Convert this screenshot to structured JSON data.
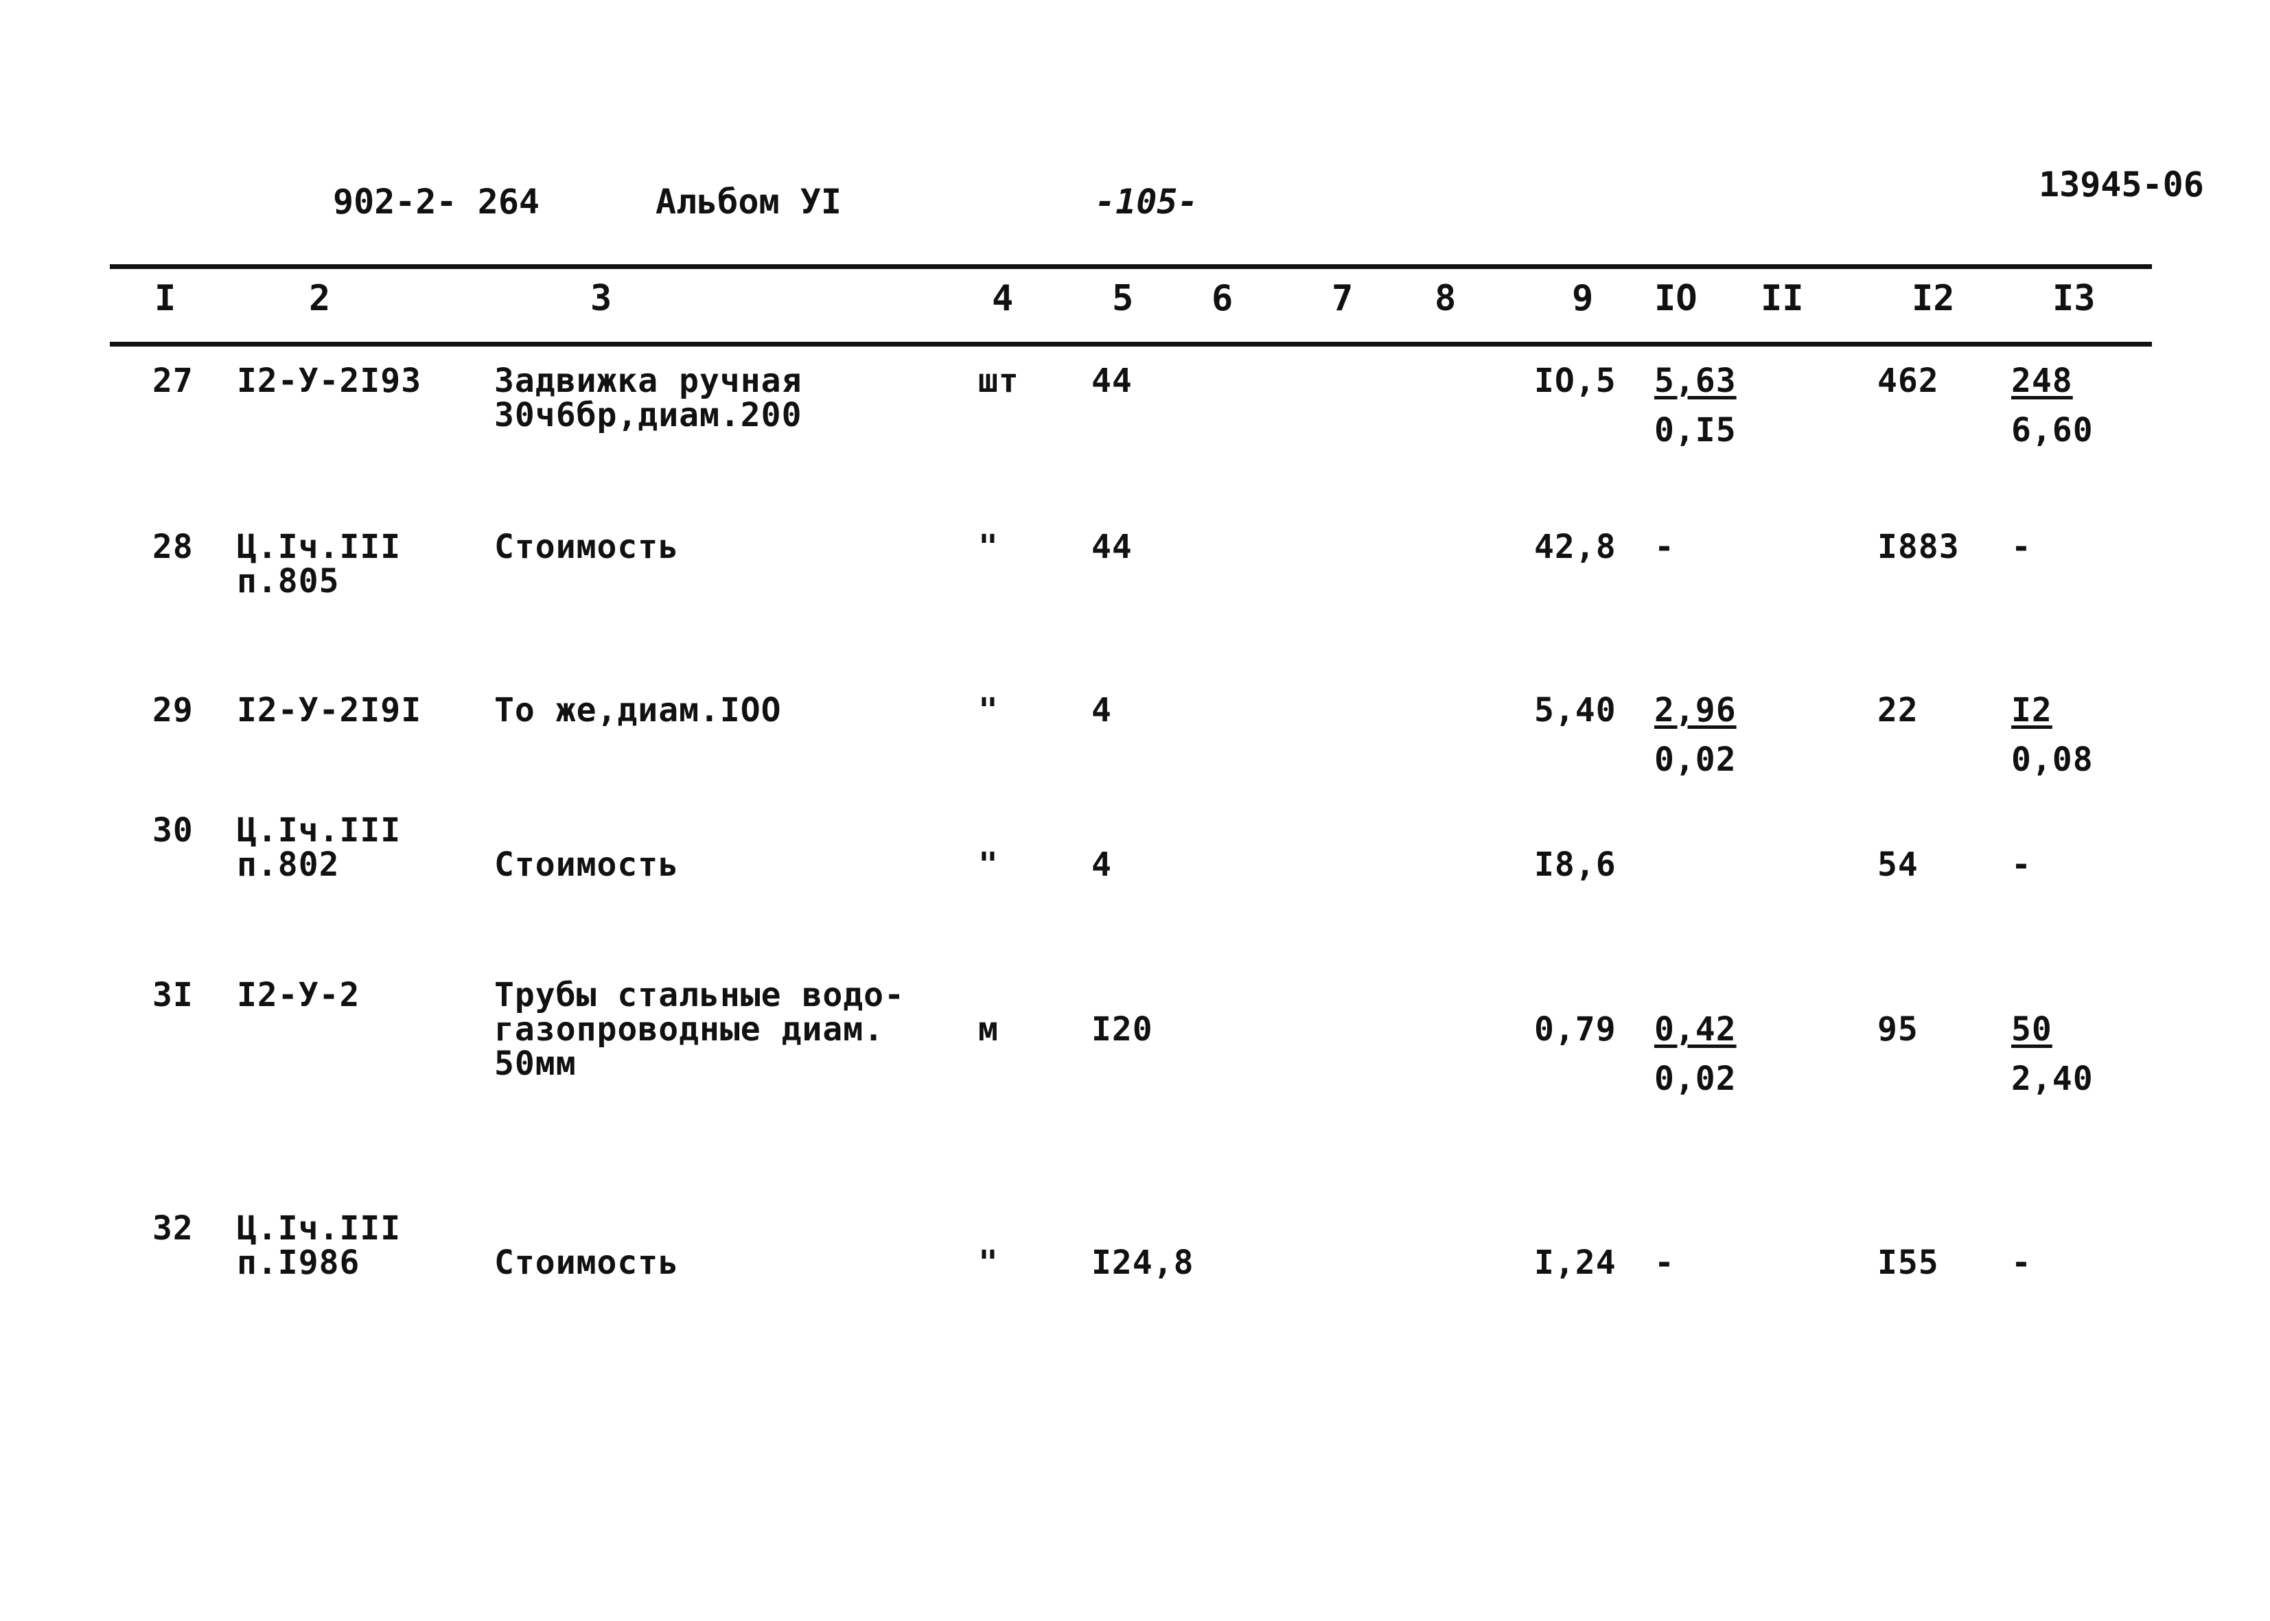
{
  "header": {
    "project_code": "902-2- 264",
    "album": "Альбом  УI",
    "page": "-105-",
    "doc_number": "13945-06"
  },
  "columns": [
    "I",
    "2",
    "3",
    "4",
    "5",
    "6",
    "7",
    "8",
    "9",
    "IO",
    "II",
    "I2",
    "I3"
  ],
  "rows": [
    {
      "n": "27",
      "code": "I2-У-2I93",
      "name": "Задвижка ручная\n30ч6бр,диам.200",
      "unit": "шт",
      "qty": "44",
      "price": "IO,5",
      "c10_top": "5,63",
      "c10_bottom": "0,I5",
      "c12": "462",
      "c13_top": "248",
      "c13_bottom": "6,60"
    },
    {
      "n": "28",
      "code": "Ц.Iч.III\nп.805",
      "name": "Стоимость",
      "unit": "\"",
      "qty": "44",
      "price": "42,8",
      "c10_top": "-",
      "c10_bottom": "",
      "c12": "I883",
      "c13_top": "-",
      "c13_bottom": ""
    },
    {
      "n": "29",
      "code": "I2-У-2I9I",
      "name": "То же,диам.IOO",
      "unit": "\"",
      "qty": "4",
      "price": "5,40",
      "c10_top": "2,96",
      "c10_bottom": "0,02",
      "c12": "22",
      "c13_top": "I2",
      "c13_bottom": "0,08"
    },
    {
      "n": "30",
      "code": "Ц.Iч.III\nп.802",
      "name": "\nСтоимость",
      "unit": "\n\"",
      "qty": "\n4",
      "price": "\nI8,6",
      "c10_top": "",
      "c10_bottom": "",
      "c12": "\n54",
      "c13_top": "\n-",
      "c13_bottom": ""
    },
    {
      "n": "3I",
      "code": "I2-У-2",
      "name": "Трубы стальные водо-\nгазопроводные диам.\n50мм",
      "unit": "\nм",
      "qty": "\nI20",
      "price": "\n0,79",
      "c10_top": "0,42",
      "c10_bottom": "0,02",
      "c12": "\n95",
      "c13_top": "50",
      "c13_bottom": "2,40"
    },
    {
      "n": "32",
      "code": "Ц.Iч.III\nп.I986",
      "name": "\nСтоимость",
      "unit": "\n\"",
      "qty": "\nI24,8",
      "price": "\nI,24",
      "c10_top": "\n-",
      "c10_bottom": "",
      "c12": "\nI55",
      "c13_top": "\n-",
      "c13_bottom": ""
    }
  ]
}
